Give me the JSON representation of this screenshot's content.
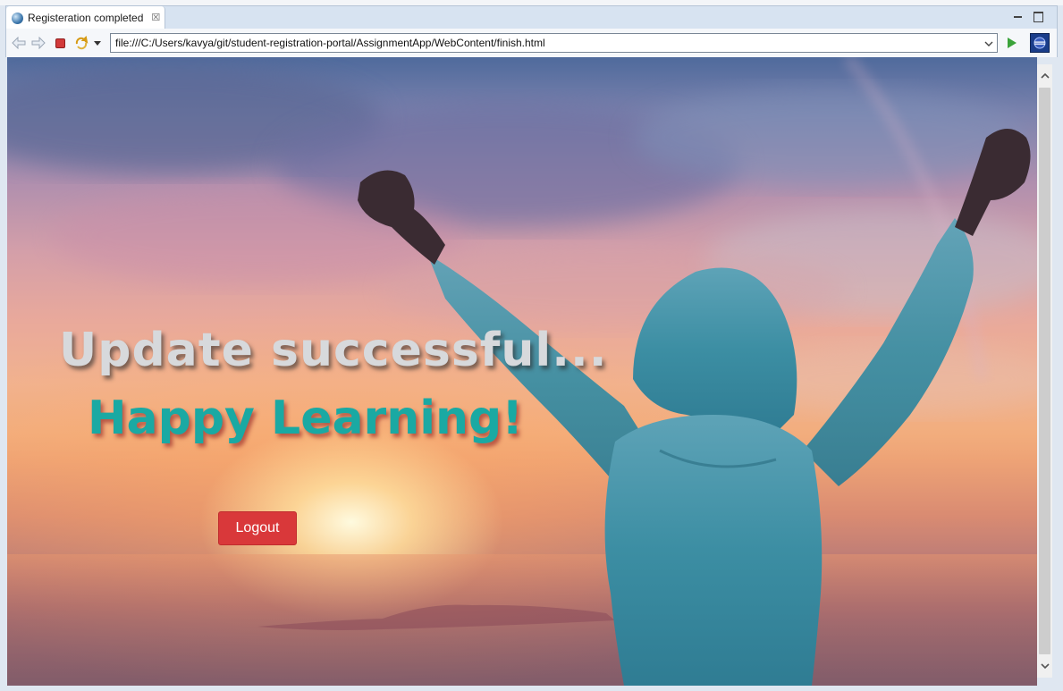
{
  "tab": {
    "title": "Registeration completed",
    "close_glyph": "☒",
    "icon": "globe-icon"
  },
  "toolbar": {
    "url": "file:///C:/Users/kavya/git/student-registration-portal/AssignmentApp/WebContent/finish.html",
    "icons": [
      "back-arrow-icon",
      "forward-arrow-icon",
      "stop-icon",
      "refresh-icon",
      "chevron-down-icon",
      "go-icon",
      "eclipse-icon"
    ]
  },
  "page": {
    "headline": "Update successful...",
    "subheadline": "Happy Learning!",
    "logout_label": "Logout"
  },
  "colors": {
    "headline": "#d7d9dc",
    "subheadline": "#1aa9a3",
    "logout_button": "#d9383a",
    "hoodie": "#3a8aa0"
  }
}
